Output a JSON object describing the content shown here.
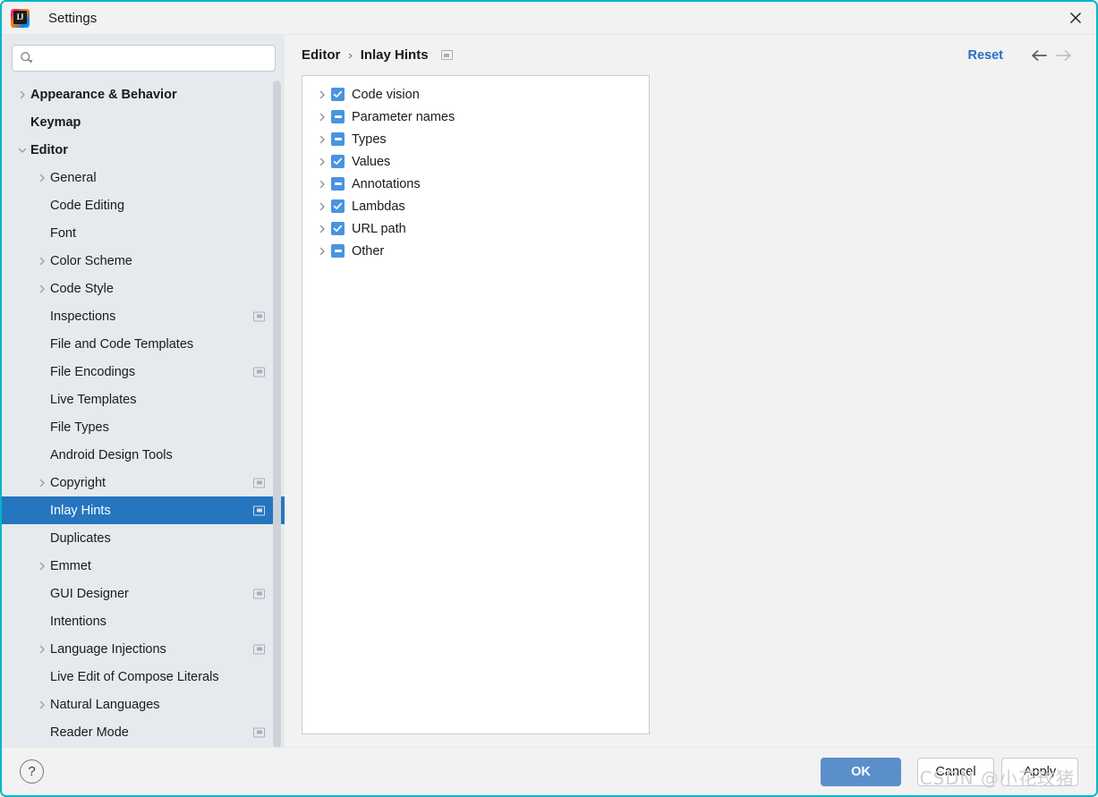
{
  "window": {
    "title": "Settings",
    "logo_icon": "intellij-idea-logo",
    "close_icon": "close-icon",
    "accent_color": "#00b5c8"
  },
  "search": {
    "value": "",
    "placeholder": "",
    "icon": "search-icon"
  },
  "sidebar": {
    "items": [
      {
        "label": "Appearance & Behavior",
        "level": 0,
        "arrow": "chevron-right",
        "bold": true,
        "badge": false,
        "selected": false
      },
      {
        "label": "Keymap",
        "level": 0,
        "arrow": "none",
        "bold": true,
        "badge": false,
        "selected": false
      },
      {
        "label": "Editor",
        "level": 0,
        "arrow": "chevron-down",
        "bold": true,
        "badge": false,
        "selected": false
      },
      {
        "label": "General",
        "level": 1,
        "arrow": "chevron-right",
        "bold": false,
        "badge": false,
        "selected": false
      },
      {
        "label": "Code Editing",
        "level": 1,
        "arrow": "none",
        "bold": false,
        "badge": false,
        "selected": false
      },
      {
        "label": "Font",
        "level": 1,
        "arrow": "none",
        "bold": false,
        "badge": false,
        "selected": false
      },
      {
        "label": "Color Scheme",
        "level": 1,
        "arrow": "chevron-right",
        "bold": false,
        "badge": false,
        "selected": false
      },
      {
        "label": "Code Style",
        "level": 1,
        "arrow": "chevron-right",
        "bold": false,
        "badge": false,
        "selected": false
      },
      {
        "label": "Inspections",
        "level": 1,
        "arrow": "none",
        "bold": false,
        "badge": true,
        "selected": false
      },
      {
        "label": "File and Code Templates",
        "level": 1,
        "arrow": "none",
        "bold": false,
        "badge": false,
        "selected": false
      },
      {
        "label": "File Encodings",
        "level": 1,
        "arrow": "none",
        "bold": false,
        "badge": true,
        "selected": false
      },
      {
        "label": "Live Templates",
        "level": 1,
        "arrow": "none",
        "bold": false,
        "badge": false,
        "selected": false
      },
      {
        "label": "File Types",
        "level": 1,
        "arrow": "none",
        "bold": false,
        "badge": false,
        "selected": false
      },
      {
        "label": "Android Design Tools",
        "level": 1,
        "arrow": "none",
        "bold": false,
        "badge": false,
        "selected": false
      },
      {
        "label": "Copyright",
        "level": 1,
        "arrow": "chevron-right",
        "bold": false,
        "badge": true,
        "selected": false
      },
      {
        "label": "Inlay Hints",
        "level": 1,
        "arrow": "none",
        "bold": false,
        "badge": true,
        "selected": true
      },
      {
        "label": "Duplicates",
        "level": 1,
        "arrow": "none",
        "bold": false,
        "badge": false,
        "selected": false
      },
      {
        "label": "Emmet",
        "level": 1,
        "arrow": "chevron-right",
        "bold": false,
        "badge": false,
        "selected": false
      },
      {
        "label": "GUI Designer",
        "level": 1,
        "arrow": "none",
        "bold": false,
        "badge": true,
        "selected": false
      },
      {
        "label": "Intentions",
        "level": 1,
        "arrow": "none",
        "bold": false,
        "badge": false,
        "selected": false
      },
      {
        "label": "Language Injections",
        "level": 1,
        "arrow": "chevron-right",
        "bold": false,
        "badge": true,
        "selected": false
      },
      {
        "label": "Live Edit of Compose Literals",
        "level": 1,
        "arrow": "none",
        "bold": false,
        "badge": false,
        "selected": false
      },
      {
        "label": "Natural Languages",
        "level": 1,
        "arrow": "chevron-right",
        "bold": false,
        "badge": false,
        "selected": false
      },
      {
        "label": "Reader Mode",
        "level": 1,
        "arrow": "none",
        "bold": false,
        "badge": true,
        "selected": false
      }
    ]
  },
  "header": {
    "breadcrumb": [
      "Editor",
      "Inlay Hints"
    ],
    "separator": "›",
    "badge_icon": "module-badge-icon",
    "reset_label": "Reset",
    "back_icon": "arrow-left-icon",
    "forward_icon": "arrow-right-icon",
    "reset_color": "#2470c4"
  },
  "hints": {
    "rows": [
      {
        "label": "Code vision",
        "state": "checked"
      },
      {
        "label": "Parameter names",
        "state": "indeterminate"
      },
      {
        "label": "Types",
        "state": "indeterminate"
      },
      {
        "label": "Values",
        "state": "checked"
      },
      {
        "label": "Annotations",
        "state": "indeterminate"
      },
      {
        "label": "Lambdas",
        "state": "checked"
      },
      {
        "label": "URL path",
        "state": "checked"
      },
      {
        "label": "Other",
        "state": "indeterminate"
      }
    ],
    "checkbox_color": "#4a93e0"
  },
  "footer": {
    "help_label": "?",
    "ok_label": "OK",
    "cancel_label": "Cancel",
    "apply_label": "Apply"
  },
  "watermark": {
    "text": "CSDN @小花玫猪"
  }
}
